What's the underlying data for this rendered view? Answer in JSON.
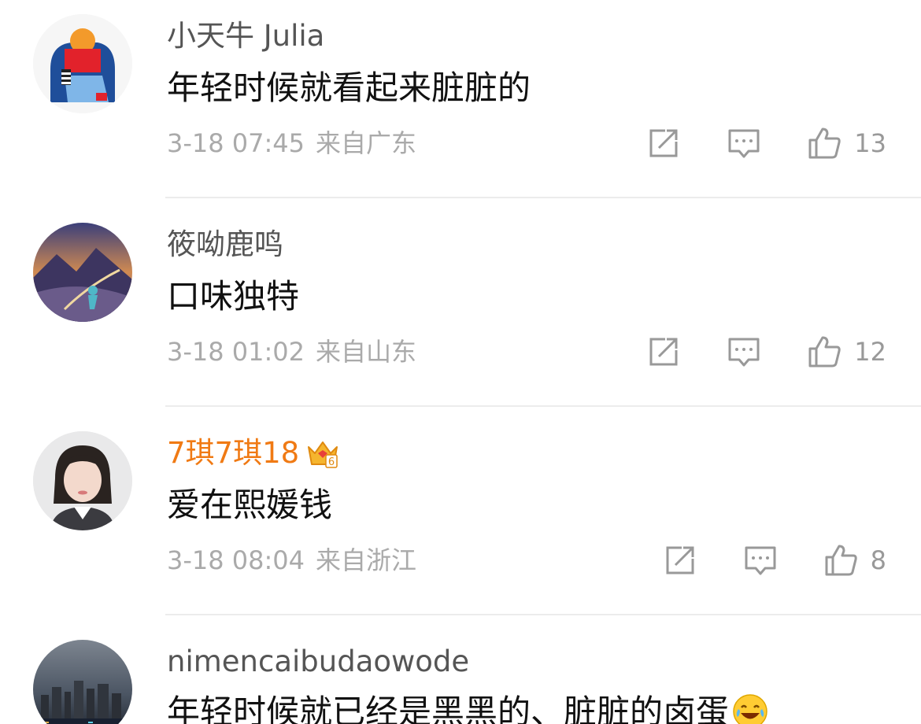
{
  "comments": [
    {
      "username": "小天牛 Julia",
      "text": "年轻时候就看起来脏脏的",
      "time": "3-18 07:45",
      "location": "来自广东",
      "likes": "13",
      "vip": false,
      "avatar": "avatar-girl-reading-icon"
    },
    {
      "username": "筱呦鹿鸣",
      "text": "口味独特",
      "time": "3-18 01:02",
      "location": "来自山东",
      "likes": "12",
      "vip": false,
      "avatar": "avatar-fantasy-landscape-icon"
    },
    {
      "username": "7琪7琪18",
      "text": "爱在熙媛钱",
      "time": "3-18 08:04",
      "location": "来自浙江",
      "likes": "8",
      "vip": true,
      "vip_level": "6",
      "avatar": "avatar-portrait-icon"
    },
    {
      "username": "nimencaibudaowode",
      "text": "年轻时候就已经是黑黑的、脏脏的卤蛋",
      "emoji": "laughing-crying-emoji",
      "avatar": "avatar-city-skyline-icon"
    }
  ],
  "colors": {
    "vip_name": "#f07a14",
    "meta_text": "#aaaaaa",
    "username": "#555555",
    "content": "#111111",
    "divider": "#ececec"
  },
  "icons": {
    "share": "share-icon",
    "reply": "reply-icon",
    "like": "thumbs-up-icon"
  }
}
